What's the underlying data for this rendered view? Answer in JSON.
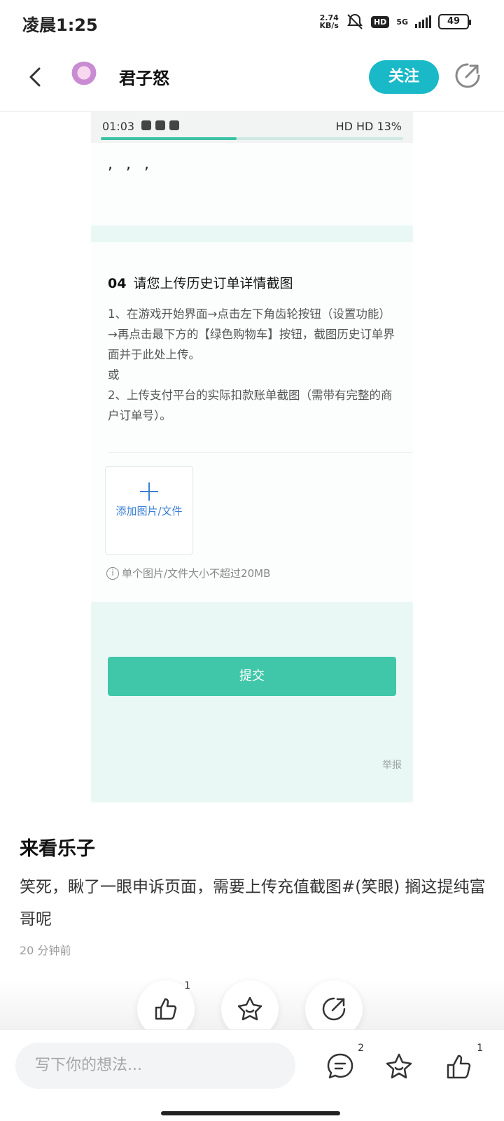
{
  "status_bar": {
    "time": "凌晨1:25",
    "speed_value": "2.74",
    "speed_unit": "KB/s",
    "hd": "HD",
    "network": "5G",
    "battery": "49"
  },
  "header": {
    "username": "君子怒",
    "follow_label": "关注"
  },
  "screenshot": {
    "time": "01:03",
    "right_status": "HD HD 13%",
    "progress": 0.45,
    "commas": ", , ,",
    "question_number": "04",
    "question_title": "请您上传历史订单详情截图",
    "question_desc": "1、在游戏开始界面→点击左下角齿轮按钮（设置功能）→再点击最下方的【绿色购物车】按钮，截图历史订单界面并于此处上传。\n或\n2、上传支付平台的实际扣款账单截图（需带有完整的商户订单号）。",
    "upload_label": "添加图片/文件",
    "limit_text": "单个图片/文件大小不超过20MB",
    "submit_label": "提交",
    "report_label": "举报"
  },
  "post": {
    "title": "来看乐子",
    "body": "笑死，瞅了一眼申诉页面，需要上传充值截图#(笑眼) 搁这提纯富哥呢",
    "time": "20 分钟前"
  },
  "actions": {
    "like_count": "1"
  },
  "bottom_bar": {
    "placeholder": "写下你的想法...",
    "comment_count": "2",
    "like_count": "1"
  },
  "colors": {
    "follow_bg": "#1ab9c8",
    "submit_bg": "#40c6a8",
    "mint_band": "#e9f8f4",
    "link_blue": "#3b7fd4"
  }
}
